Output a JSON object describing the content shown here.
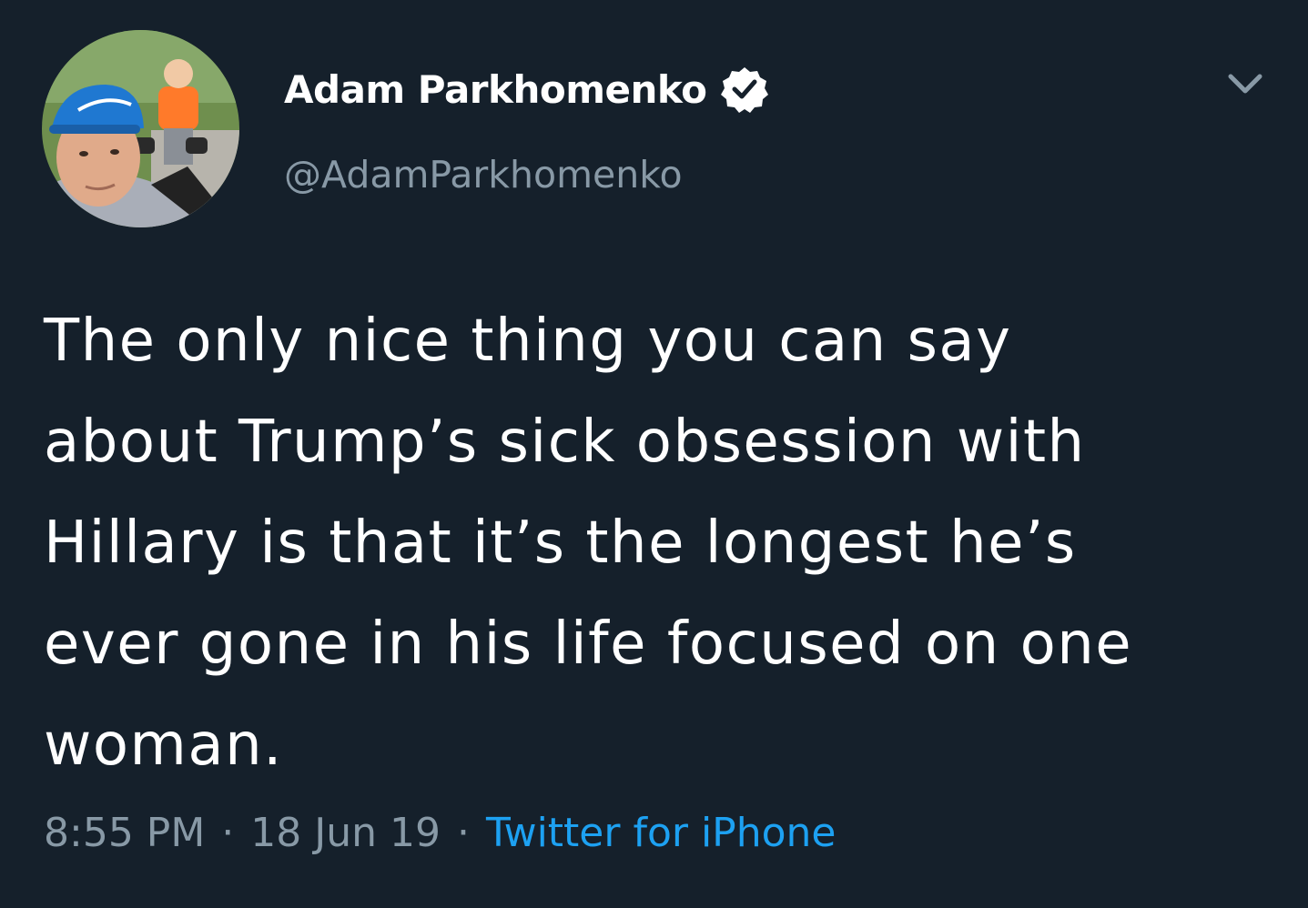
{
  "author": {
    "display_name": "Adam Parkhomenko",
    "handle": "@AdamParkhomenko",
    "verified": true,
    "avatar_icon": "profile-photo"
  },
  "tweet": {
    "text": "The only nice thing you can say\nabout Trump’s sick obsession with\nHillary is that it’s the longest he’s\never gone in his life focused on one\nwoman."
  },
  "meta": {
    "time": "8:55 PM",
    "separator": "·",
    "date": "18 Jun 19",
    "source": "Twitter for iPhone"
  },
  "icons": {
    "verified": "verified-badge-icon",
    "menu": "chevron-down-icon"
  },
  "colors": {
    "background": "#15202b",
    "primary_text": "#ffffff",
    "secondary_text": "#8899a6",
    "link": "#1da1f2"
  }
}
